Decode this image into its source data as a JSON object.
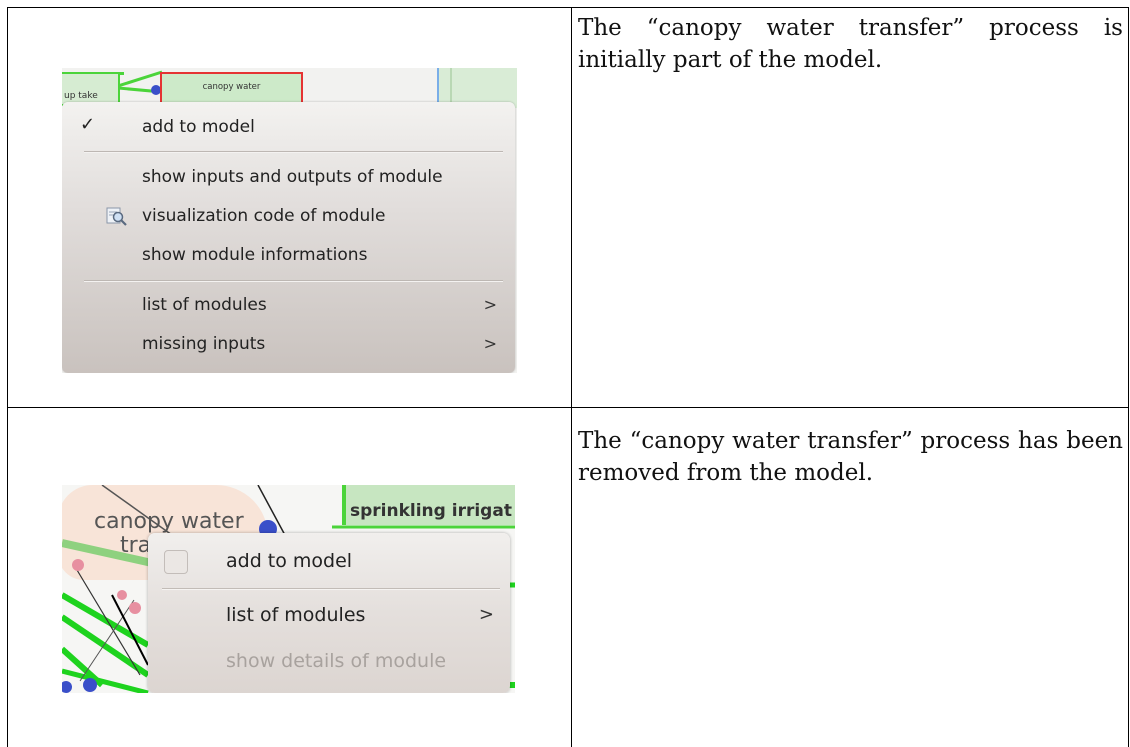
{
  "rows": [
    {
      "description": "The “canopy water transfer” process is initially part of the model.",
      "screenshot": {
        "background_nodes": {
          "uptake": "up take",
          "canopy_water": "canopy water"
        },
        "menu": {
          "items": [
            {
              "label": "add to model",
              "checked": true,
              "icon": "checkmark-icon"
            },
            {
              "label": "show inputs and outputs of module"
            },
            {
              "label": "visualization code of module",
              "icon": "magnifier-icon"
            },
            {
              "label": "show module informations"
            },
            {
              "label": "list of modules",
              "submenu": true
            },
            {
              "label": "missing inputs",
              "submenu": true
            }
          ]
        }
      }
    },
    {
      "description": "The “canopy water transfer” process has been removed from the model.",
      "screenshot": {
        "background_nodes": {
          "canopy_line1": "canopy water",
          "canopy_line2": "tra",
          "sprinkling": "sprinkling irrigat"
        },
        "menu": {
          "items": [
            {
              "label": "add to model",
              "checked": false,
              "icon": "checkbox-icon"
            },
            {
              "label": "list of modules",
              "submenu": true
            },
            {
              "label": "show details of module",
              "disabled": true
            }
          ]
        }
      }
    }
  ],
  "colors": {
    "node_green": "#4bd43a",
    "node_red_border": "#e53333",
    "node_blue": "#3a4fc9"
  },
  "arrow_glyph": ">"
}
